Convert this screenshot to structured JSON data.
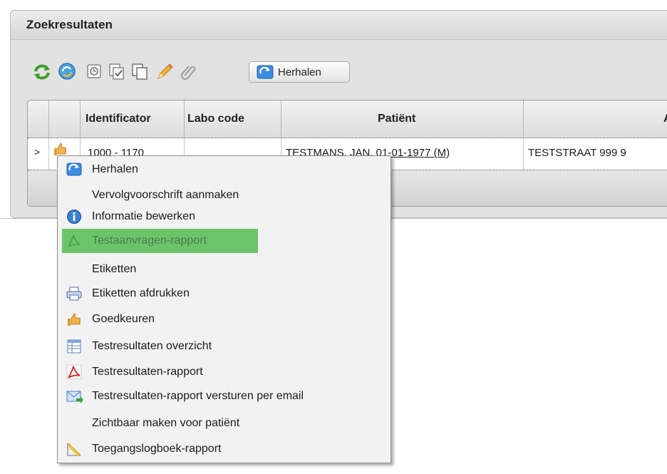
{
  "panel": {
    "title": "Zoekresultaten"
  },
  "toolbar": {
    "icons": [
      "refresh-icon",
      "sync-icon",
      "clock-icon",
      "checked-copy-icon",
      "copy-icon",
      "pencil-icon",
      "paperclip-icon"
    ],
    "herhalen_label": "Herhalen"
  },
  "grid": {
    "columns": [
      "Identificator",
      "Labo code",
      "Patiënt",
      "Ac"
    ],
    "row": {
      "expander": ">",
      "identificator": "1000 - 1170",
      "labo_code": "",
      "patient": "TESTMANS, JAN, 01-01-1977 (M)",
      "address": "TESTSTRAAT 999 9"
    }
  },
  "context_menu": {
    "items": [
      {
        "label": "Herhalen",
        "icon": "repeat-icon"
      },
      {
        "label": "Vervolgvoorschrift aanmaken",
        "icon": ""
      },
      {
        "label": "Informatie bewerken",
        "icon": "info-icon"
      },
      {
        "label": "Testaanvragen-rapport",
        "icon": "pdf-icon",
        "highlighted": true
      },
      {
        "label": "Etiketten",
        "icon": ""
      },
      {
        "label": "Etiketten afdrukken",
        "icon": "printer-icon"
      },
      {
        "label": "Goedkeuren",
        "icon": "thumbs-up-icon"
      },
      {
        "label": "Testresultaten overzicht",
        "icon": "table-icon"
      },
      {
        "label": "Testresultaten-rapport",
        "icon": "pdf-icon"
      },
      {
        "label": "Testresultaten-rapport versturen per email",
        "icon": "email-send-icon"
      },
      {
        "label": "Zichtbaar maken voor patiënt",
        "icon": ""
      },
      {
        "label": "Toegangslogboek-rapport",
        "icon": "log-report-icon"
      }
    ]
  },
  "colors": {
    "highlight": "#6cc46a",
    "accent_blue": "#2f7fd6"
  }
}
